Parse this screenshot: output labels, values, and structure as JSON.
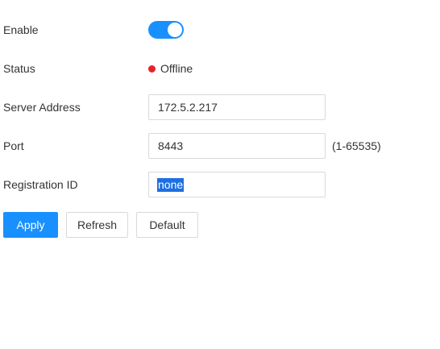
{
  "enable": {
    "label": "Enable",
    "state": "on",
    "toggle_color": "#1890ff"
  },
  "status": {
    "label": "Status",
    "value": "Offline",
    "dot_color": "#e8222a"
  },
  "server_address": {
    "label": "Server Address",
    "value": "172.5.2.217"
  },
  "port": {
    "label": "Port",
    "value": "8443",
    "range_hint": "(1-65535)"
  },
  "registration_id": {
    "label": "Registration ID",
    "value": "none",
    "text_selected": true
  },
  "actions": {
    "apply_label": "Apply",
    "refresh_label": "Refresh",
    "default_label": "Default",
    "primary_color": "#1890ff"
  }
}
